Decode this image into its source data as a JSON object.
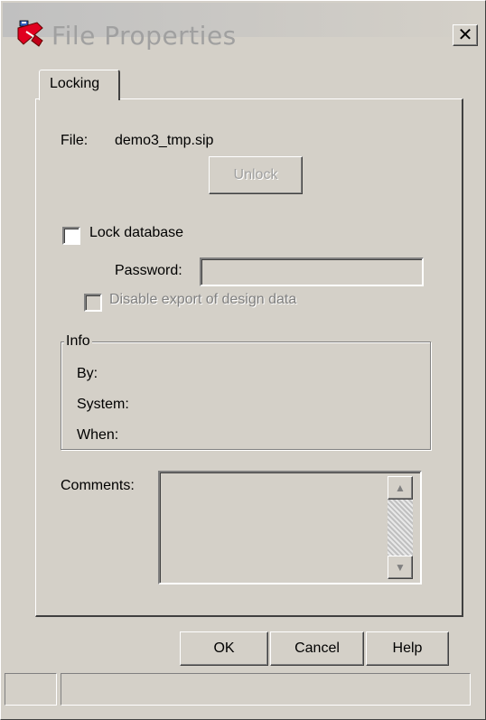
{
  "window": {
    "title": "File Properties",
    "close_label": "✕"
  },
  "tabs": [
    {
      "label": "Locking"
    }
  ],
  "file": {
    "label": "File:",
    "value": "demo3_tmp.sip"
  },
  "unlock_button": "Unlock",
  "lock_database": {
    "label": "Lock database",
    "checked": false
  },
  "password": {
    "label": "Password:",
    "value": ""
  },
  "disable_export": {
    "label": "Disable export of design data",
    "checked": false,
    "enabled": false
  },
  "info": {
    "title": "Info",
    "by_label": "By:",
    "system_label": "System:",
    "when_label": "When:"
  },
  "comments": {
    "label": "Comments:",
    "value": ""
  },
  "buttons": {
    "ok": "OK",
    "cancel": "Cancel",
    "help": "Help"
  },
  "icons": {
    "title": "app-icon",
    "scroll_up": "scroll-up-icon",
    "scroll_down": "scroll-down-icon"
  }
}
